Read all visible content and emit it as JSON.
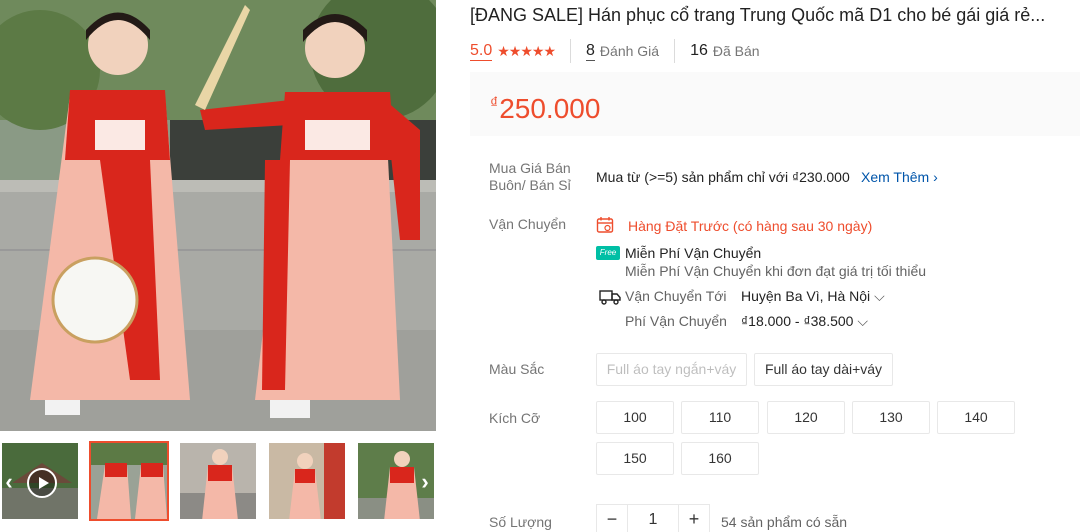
{
  "product": {
    "title": "[ĐANG SALE] Hán phục cổ trang Trung Quốc mã D1 cho bé gái giá rẻ...",
    "rating": "5.0",
    "stars": "★★★★★",
    "reviews_count": "8",
    "reviews_label": "Đánh Giá",
    "sold_count": "16",
    "sold_label": "Đã Bán",
    "currency": "₫",
    "price": "250.000"
  },
  "wholesale": {
    "label": "Mua Giá Bán Buôn/ Bán Sỉ",
    "text": "Mua từ (>=5) sản phẩm chỉ với ₫230.000",
    "link": "Xem Thêm",
    "link_icon": "chevron-right"
  },
  "shipping": {
    "label": "Vận Chuyển",
    "preorder": "Hàng Đặt Trước (có hàng sau 30 ngày)",
    "free_badge": "Free",
    "free_title": "Miễn Phí Vận Chuyển",
    "free_desc": "Miễn Phí Vận Chuyển khi đơn đạt giá trị tối thiểu",
    "to_label": "Vận Chuyển Tới",
    "to_value": "Huyện Ba Vì, Hà Nội",
    "fee_label": "Phí Vận Chuyển",
    "fee_value": "₫18.000 - ₫38.500"
  },
  "color": {
    "label": "Màu Sắc",
    "options": [
      "Full áo tay ngắn+váy",
      "Full áo tay dài+váy"
    ]
  },
  "size": {
    "label": "Kích Cỡ",
    "options": [
      "100",
      "110",
      "120",
      "130",
      "140",
      "150",
      "160"
    ]
  },
  "quantity": {
    "label": "Số Lượng",
    "minus": "−",
    "value": "1",
    "plus": "+",
    "stock": "54 sản phẩm có sẵn"
  },
  "gallery": {
    "prev_icon": "chevron-left",
    "next_icon": "chevron-right",
    "thumbnail_count": 5
  },
  "colors": {
    "accent": "#ee4d2d",
    "link": "#0055aa",
    "price_bg": "#fafafa"
  }
}
